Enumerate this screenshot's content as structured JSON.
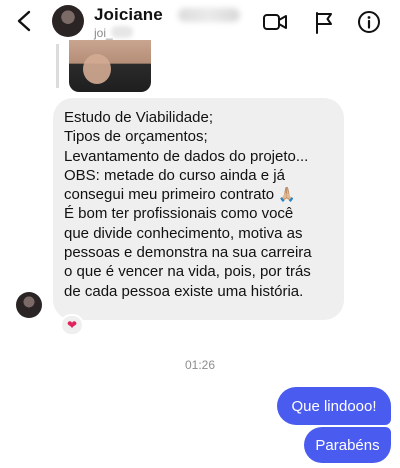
{
  "header": {
    "name": "Joiciane",
    "username": "joi_",
    "icons": [
      "back-arrow-icon",
      "video-call-icon",
      "flag-icon",
      "info-icon"
    ]
  },
  "conversation": {
    "received": {
      "lines": [
        "Estudo de Viabilidade;",
        "Tipos de orçamentos;",
        "Levantamento de dados do projeto...",
        "OBS: metade do curso ainda e já",
        "consegui meu primeiro contrato",
        "É bom ter profissionais como você",
        "que divide conhecimento,  motiva as",
        "pessoas  e demonstra na sua carreira",
        "o que é vencer na vida, pois, por trás",
        "de cada pessoa existe uma história."
      ],
      "emoji": "🙏🏼",
      "reaction": "❤"
    },
    "timestamp": "01:26",
    "sent": [
      {
        "text": "Que lindooo!"
      },
      {
        "text": "Parabéns"
      }
    ]
  },
  "colors": {
    "sent_bubble": "#4a5cf0",
    "received_bubble": "#efefef",
    "reaction_heart": "#e0245e"
  }
}
